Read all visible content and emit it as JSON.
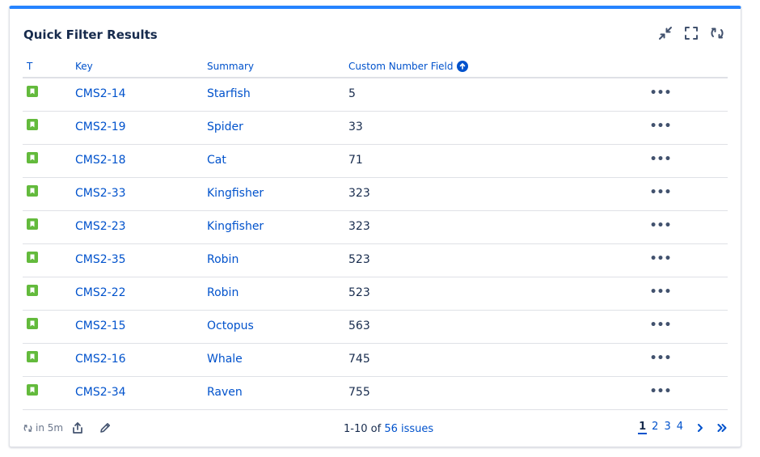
{
  "gadget": {
    "title": "Quick Filter Results",
    "accent_color": "#2684ff",
    "header_actions": [
      {
        "name": "minimize-icon",
        "label": "Minimize"
      },
      {
        "name": "maximize-icon",
        "label": "Maximize"
      },
      {
        "name": "refresh-icon",
        "label": "Refresh"
      }
    ]
  },
  "table": {
    "columns": {
      "type": "T",
      "key": "Key",
      "summary": "Summary",
      "custom_number": "Custom Number Field"
    },
    "sort": {
      "column": "custom_number",
      "direction": "ascending",
      "icon": "arrow-up-icon"
    },
    "rows": [
      {
        "type": "story",
        "key": "CMS2-14",
        "summary": "Starfish",
        "value": "5"
      },
      {
        "type": "story",
        "key": "CMS2-19",
        "summary": "Spider",
        "value": "33"
      },
      {
        "type": "story",
        "key": "CMS2-18",
        "summary": "Cat",
        "value": "71"
      },
      {
        "type": "story",
        "key": "CMS2-33",
        "summary": "Kingfisher",
        "value": "323"
      },
      {
        "type": "story",
        "key": "CMS2-23",
        "summary": "Kingfisher",
        "value": "323"
      },
      {
        "type": "story",
        "key": "CMS2-35",
        "summary": "Robin",
        "value": "523"
      },
      {
        "type": "story",
        "key": "CMS2-22",
        "summary": "Robin",
        "value": "523"
      },
      {
        "type": "story",
        "key": "CMS2-15",
        "summary": "Octopus",
        "value": "563"
      },
      {
        "type": "story",
        "key": "CMS2-16",
        "summary": "Whale",
        "value": "745"
      },
      {
        "type": "story",
        "key": "CMS2-34",
        "summary": "Raven",
        "value": "755"
      }
    ],
    "more_label": "•••",
    "story_color": "#63ba3c"
  },
  "footer": {
    "refresh_text": "in 5m",
    "range_text": "1-10 of ",
    "issues_link": "56 issues",
    "pages": [
      "1",
      "2",
      "3",
      "4"
    ],
    "current_page": "1"
  }
}
